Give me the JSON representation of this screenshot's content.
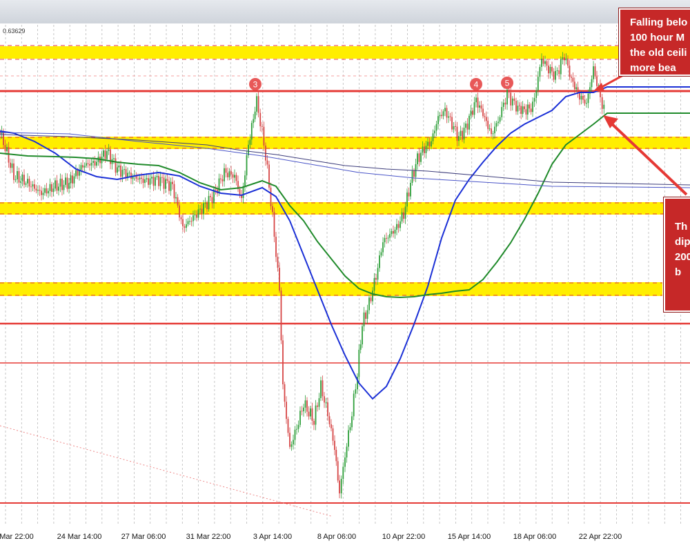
{
  "chart_data": {
    "type": "line",
    "price_label": "0.63629",
    "x_ticks": [
      "Mar 22:00",
      "24 Mar 14:00",
      "27 Mar 06:00",
      "31 Mar 22:00",
      "3 Apr 14:00",
      "8 Apr 06:00",
      "10 Apr 22:00",
      "15 Apr 14:00",
      "18 Apr 06:00",
      "22 Apr 22:00"
    ],
    "markers": [
      "3",
      "4",
      "5"
    ],
    "annotations": [
      {
        "lines": [
          "Falling belo",
          "100 hour M",
          "the old ceili",
          "more bea"
        ]
      },
      {
        "lines": [
          "Th",
          "dip",
          "200",
          "b"
        ]
      }
    ],
    "colors": {
      "ma_100": "#1a2fd6",
      "ma_200": "#1f8a2a",
      "zone": "#ffee00",
      "level": "#e53935",
      "up_candle": "#2e9e3a",
      "down_candle": "#d64545",
      "note_bg": "#c62828"
    }
  },
  "window": {
    "title_bar": ""
  }
}
